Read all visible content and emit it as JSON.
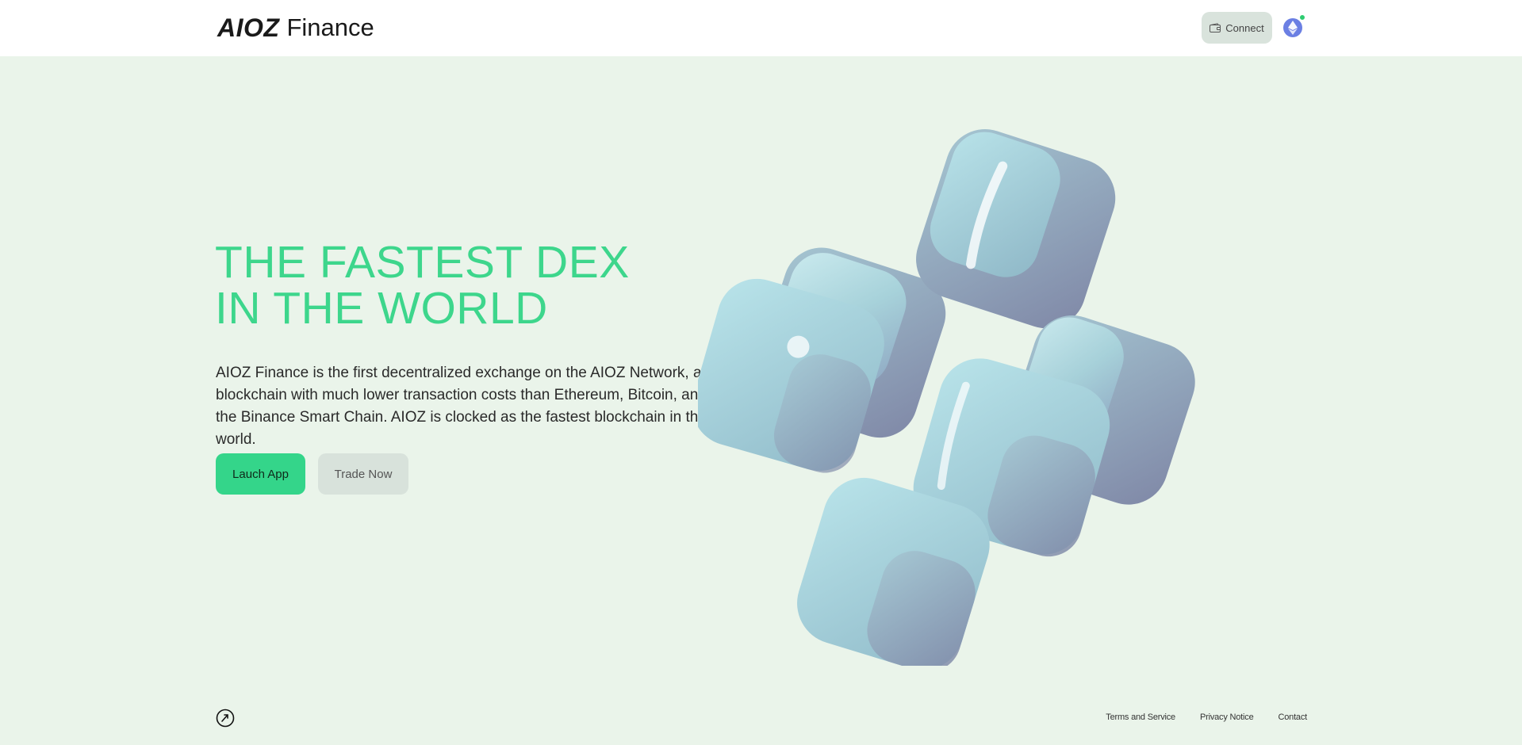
{
  "header": {
    "logo_brand": "AIOZ",
    "logo_word": "Finance",
    "connect_label": "Connect",
    "network_icon": "ethereum-icon",
    "status_color": "#2ecc71"
  },
  "hero": {
    "title_line1": "THE FASTEST DEX",
    "title_line2": "IN THE WORLD",
    "description": "AIOZ Finance is the first decentralized exchange on the AIOZ Network, a blockchain with much lower transaction costs than Ethereum, Bitcoin, and the Binance Smart Chain. AIOZ is clocked as the fastest blockchain in the world.",
    "primary_button": "Lauch App",
    "secondary_button": "Trade Now",
    "illustration": "glossy-cubes-illustration"
  },
  "footer": {
    "icon": "compass-arrow-icon",
    "links": [
      "Terms and Service",
      "Privacy Notice",
      "Contact"
    ]
  },
  "colors": {
    "background": "#eaf4ea",
    "accent": "#3dd68c",
    "button_primary": "#34d58a",
    "button_secondary": "#d8e2db"
  }
}
